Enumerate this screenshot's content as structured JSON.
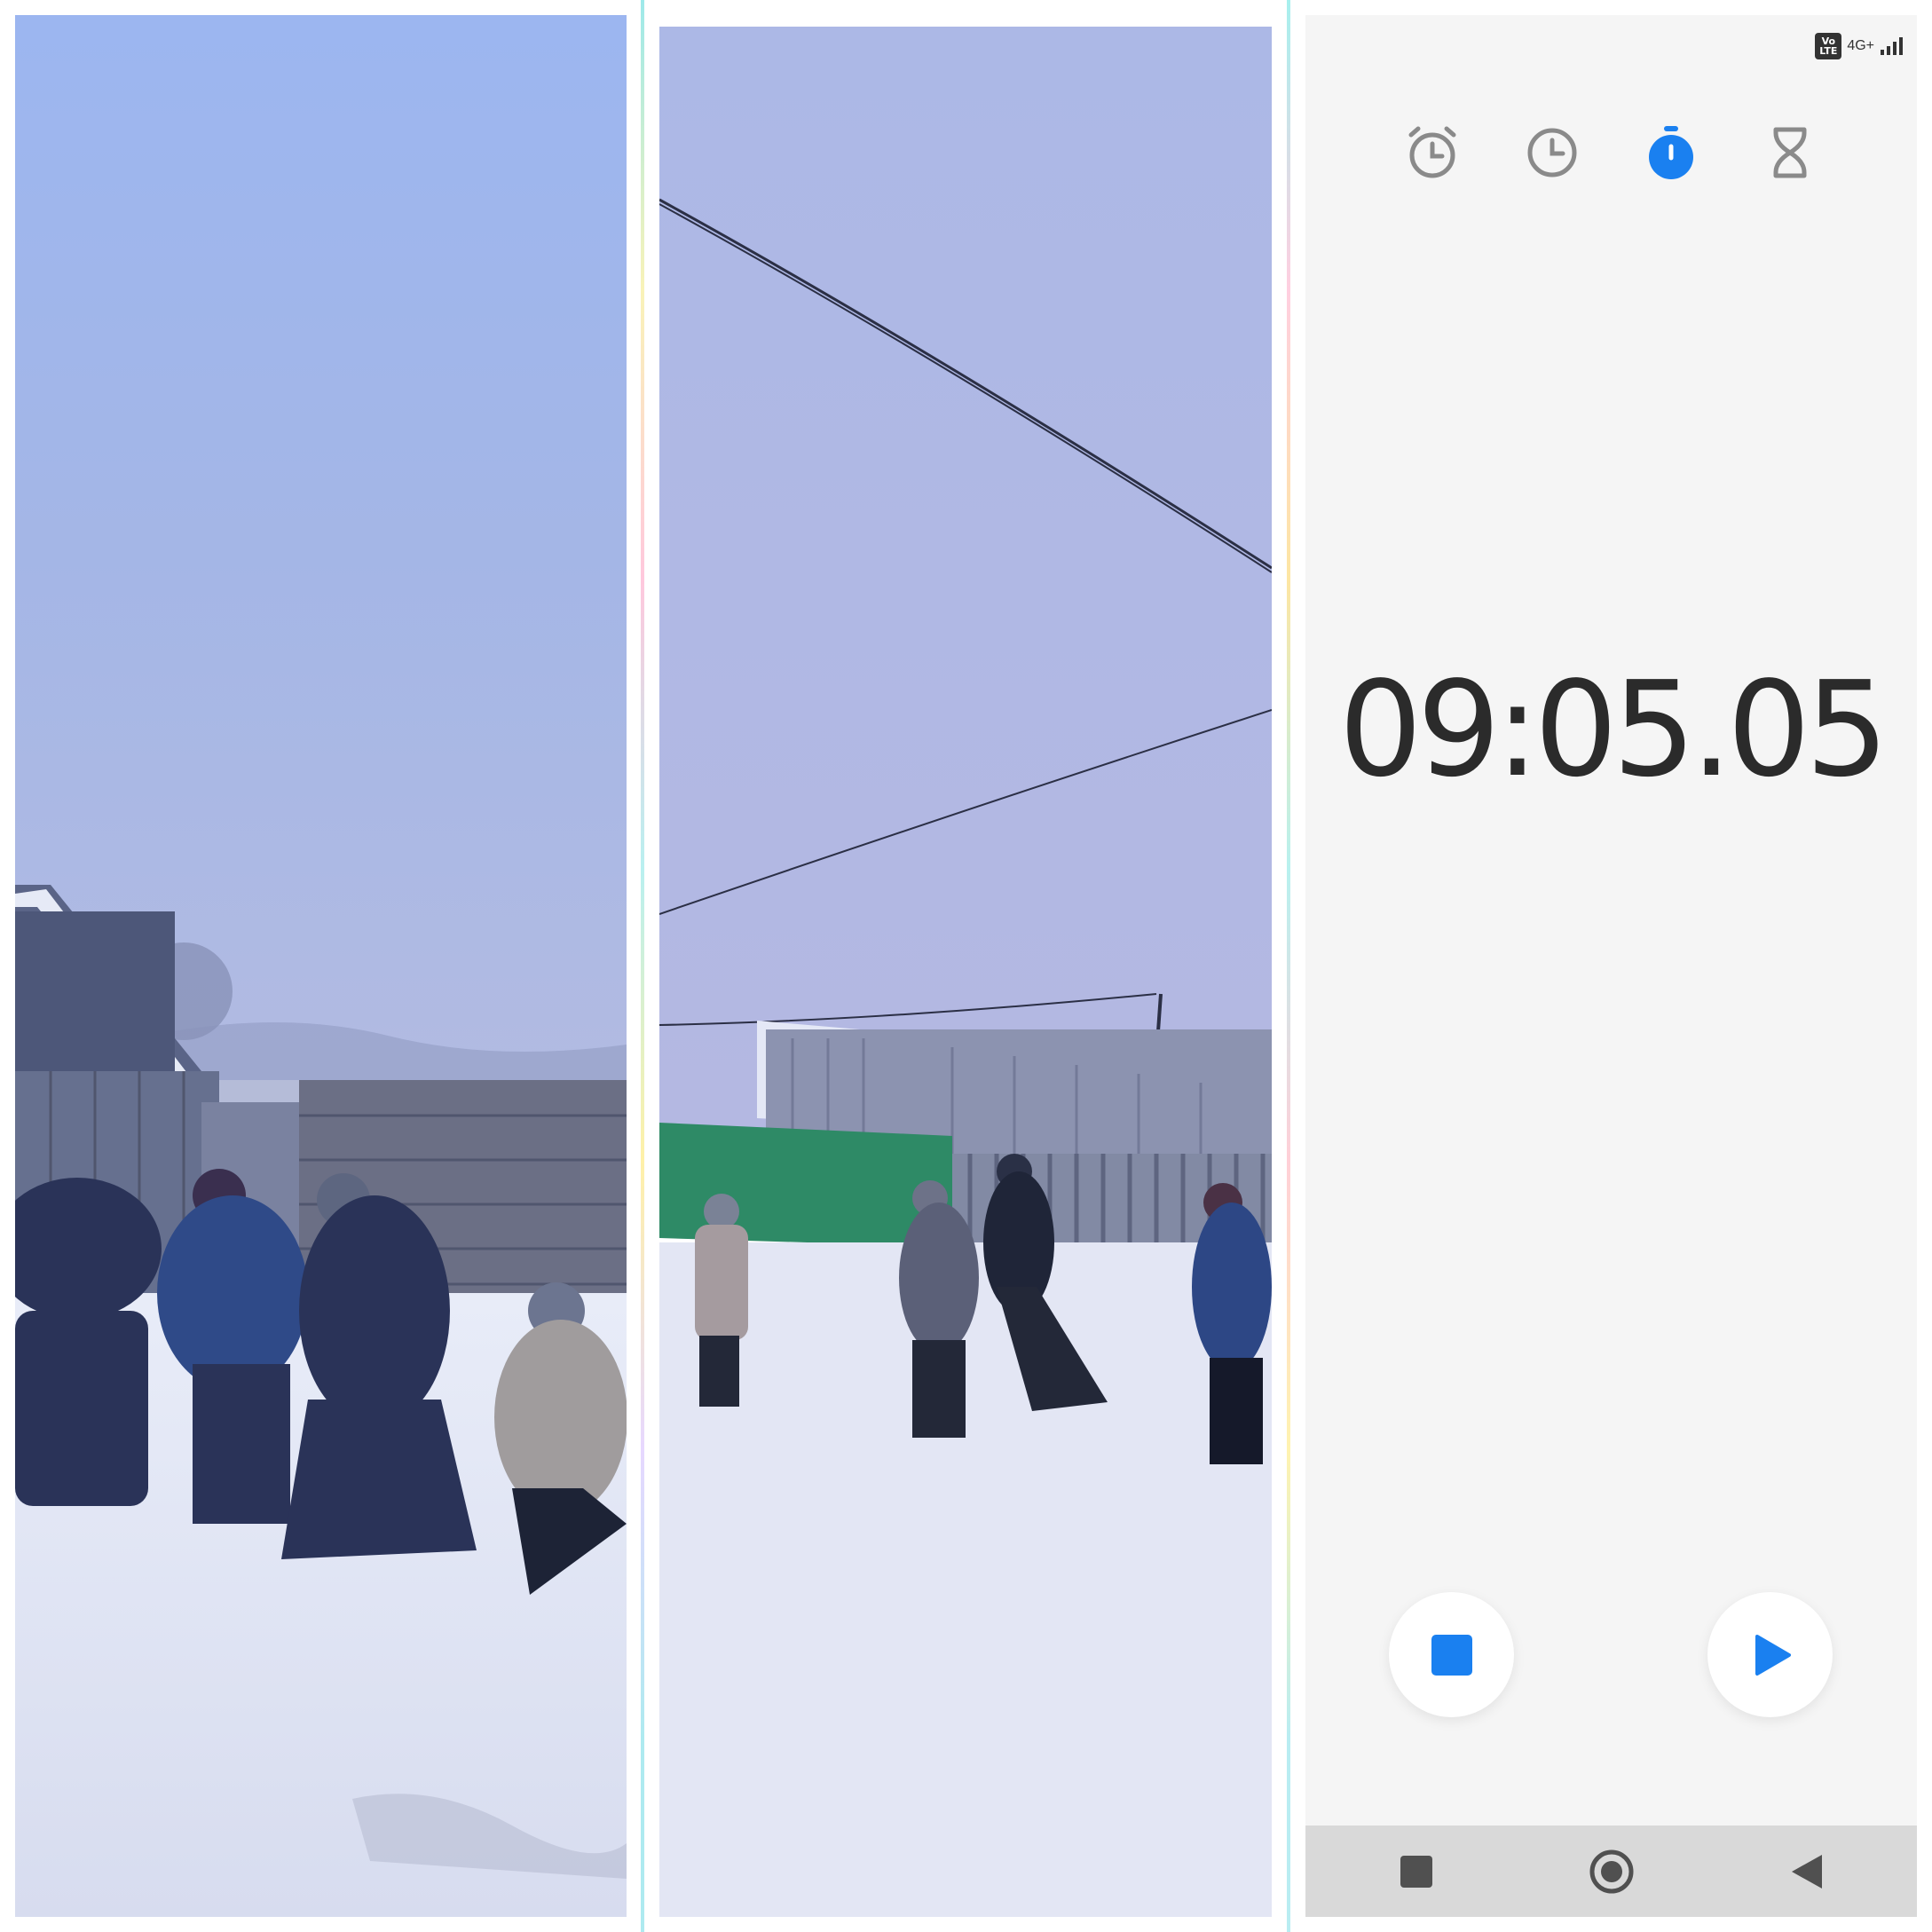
{
  "stopwatch": {
    "time": "09:05.05"
  },
  "status_bar": {
    "volte_badge": "Vo LTE",
    "network": "4G+"
  },
  "tabs": [
    {
      "name": "alarm",
      "icon": "alarm-clock-icon",
      "active": false
    },
    {
      "name": "clock",
      "icon": "clock-icon",
      "active": false
    },
    {
      "name": "stopwatch",
      "icon": "stopwatch-icon",
      "active": true
    },
    {
      "name": "timer",
      "icon": "hourglass-icon",
      "active": false
    }
  ],
  "colors": {
    "accent": "#1a80f0",
    "inactive_icon": "#8a8a8a",
    "time_text": "#2b2b2b",
    "phone_bg": "#f5f5f5",
    "nav_bg": "#d9d9d9"
  },
  "controls": {
    "stop_icon": "stop-square-icon",
    "resume_icon": "play-icon"
  },
  "navigation": {
    "recents_icon": "square-icon",
    "home_icon": "circle-icon",
    "back_icon": "triangle-back-icon"
  },
  "photos": [
    {
      "scene": "snow-yard-left",
      "description_visible": false
    },
    {
      "scene": "snow-yard-middle",
      "description_visible": false
    }
  ]
}
